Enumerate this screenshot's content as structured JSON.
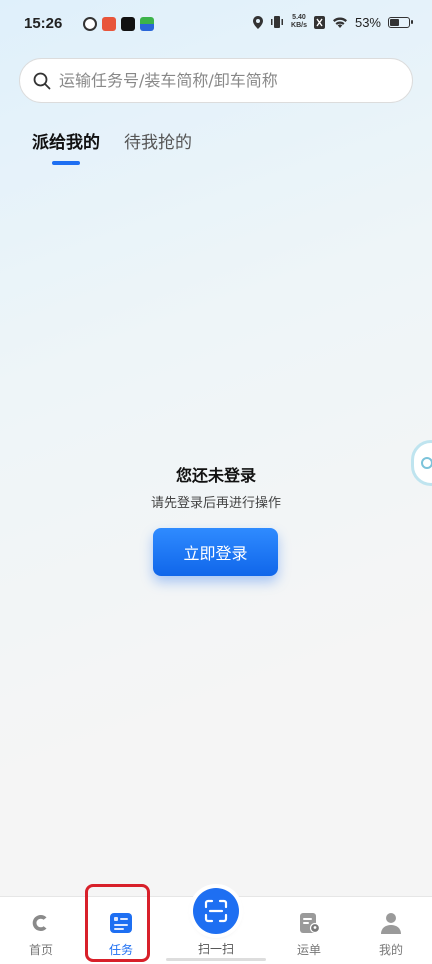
{
  "status_bar": {
    "time": "15:26",
    "speed_value": "5.40",
    "speed_unit": "KB/s",
    "battery": "53%",
    "battery_level": 0.53
  },
  "search": {
    "placeholder": "运输任务号/装车简称/卸车简称",
    "value": ""
  },
  "tabs": [
    {
      "label": "派给我的",
      "active": true
    },
    {
      "label": "待我抢的",
      "active": false
    }
  ],
  "empty_state": {
    "title": "您还未登录",
    "subtitle": "请先登录后再进行操作",
    "button": "立即登录"
  },
  "bottom_nav": {
    "home": "首页",
    "task": "任务",
    "scan": "扫一扫",
    "waybill": "运单",
    "mine": "我的"
  },
  "colors": {
    "accent": "#1e6ff2",
    "highlight": "#d8202a"
  }
}
